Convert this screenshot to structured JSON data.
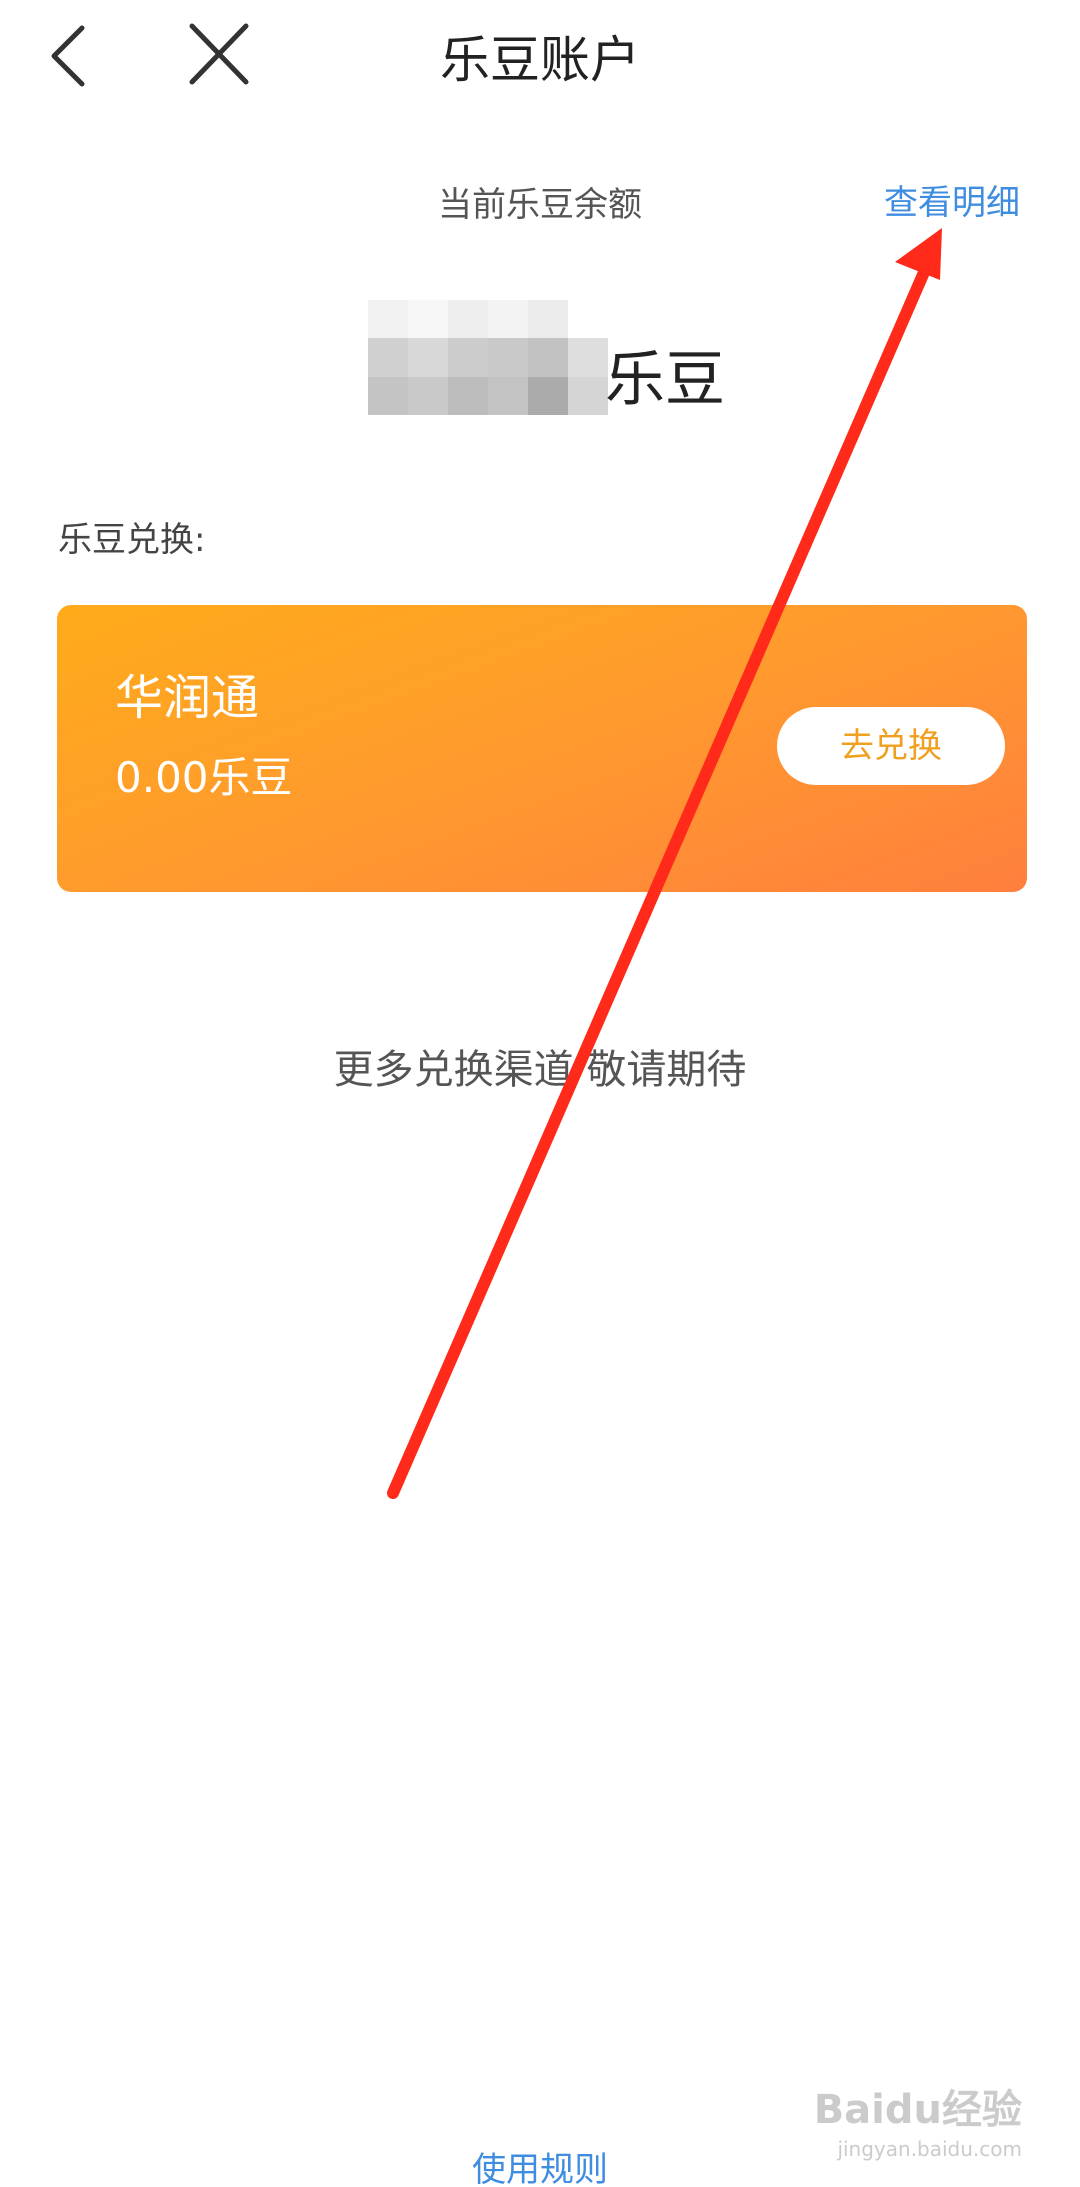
{
  "header": {
    "title": "乐豆账户"
  },
  "balance": {
    "label": "当前乐豆余额",
    "details_link": "查看明细",
    "unit": "乐豆"
  },
  "exchange": {
    "section_label": "乐豆兑换:",
    "card": {
      "name": "华润通",
      "amount": "0.00乐豆",
      "button_label": "去兑换"
    },
    "more_channels": "更多兑换渠道  敬请期待"
  },
  "footer": {
    "rules_link": "使用规则"
  },
  "colors": {
    "accent_link": "#3f8de0",
    "card_gradient_start": "#ffab1a",
    "card_gradient_end": "#ff7f3d",
    "button_text": "#f0a020",
    "annotation_arrow": "#ff2a1a"
  },
  "icons": {
    "back": "chevron-left-icon",
    "close": "close-icon"
  },
  "watermark": {
    "logo": "Baidu经验",
    "url": "jingyan.baidu.com"
  }
}
